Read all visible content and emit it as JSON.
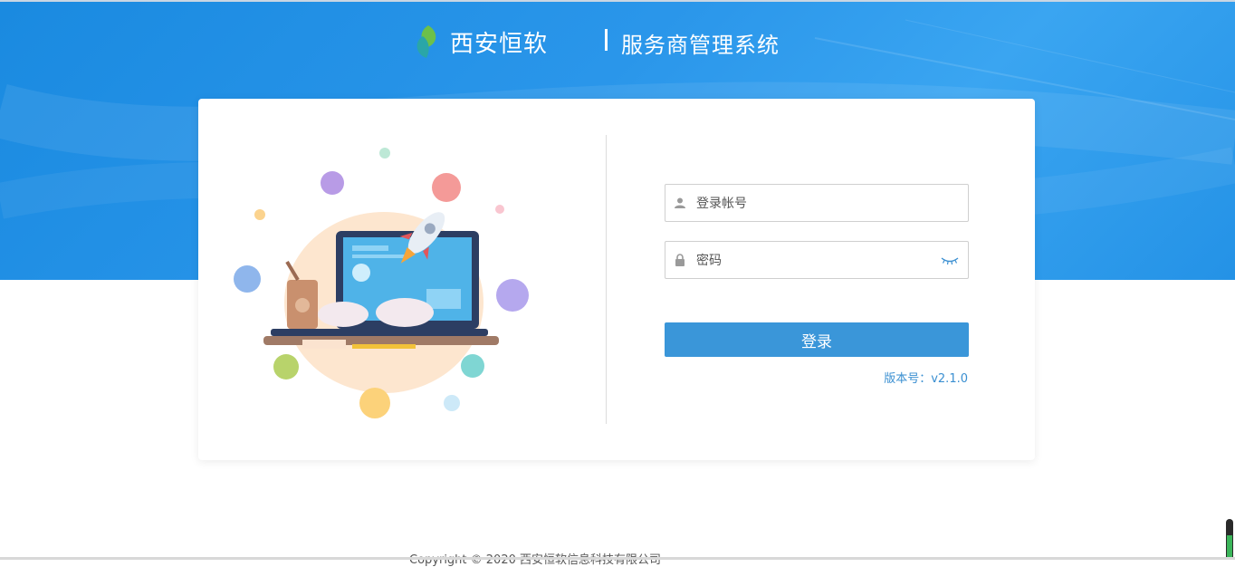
{
  "header": {
    "brand_name": "西安恒软",
    "system_title": "服务商管理系统"
  },
  "login": {
    "account_placeholder": "登录帐号",
    "password_placeholder": "密码",
    "submit_label": "登录",
    "version": "版本号：v2.1.0"
  },
  "footer": {
    "copyright": "Copyright © 2020 西安恒软信息科技有限公司"
  },
  "icons": {
    "logo": "leaf-logo-icon",
    "account": "user-icon",
    "password": "lock-icon",
    "toggle_password": "eye-closed-icon"
  },
  "colors": {
    "header_blue": "#1e8fe6",
    "button_blue": "#3a96d9",
    "link_blue": "#3a8fd1"
  }
}
